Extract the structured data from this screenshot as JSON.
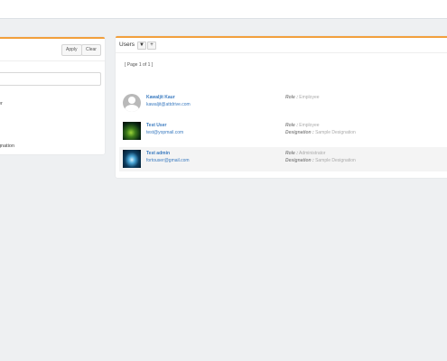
{
  "filter": {
    "apply_label": "Apply",
    "clear_label": "Clear",
    "option_1": "er",
    "option_2": "gnation"
  },
  "users": {
    "title": "Users",
    "filter_icon": "▼",
    "add_icon": "+",
    "pager": "[ Page 1 of 1 ]",
    "list": [
      {
        "name": "Kawaljit Kaur",
        "email": "kawaljit@attdrive.com",
        "role_label": "Role :",
        "role": "Employee",
        "designation_label": "",
        "designation": "",
        "avatar": "default-avatar"
      },
      {
        "name": "Test User",
        "email": "test@yopmail.com",
        "role_label": "Role :",
        "role": "Employee",
        "designation_label": "Designation :",
        "designation": "Sample Designation",
        "avatar": "photo-green"
      },
      {
        "name": "Test admin",
        "email": "fortouser@gmail.com",
        "role_label": "Role :",
        "role": "Administrator",
        "designation_label": "Designation :",
        "designation": "Sample Designation",
        "avatar": "photo-blue"
      }
    ]
  },
  "colors": {
    "accent": "#f2a03d",
    "link": "#3b7bc0",
    "background": "#eef0f2"
  }
}
